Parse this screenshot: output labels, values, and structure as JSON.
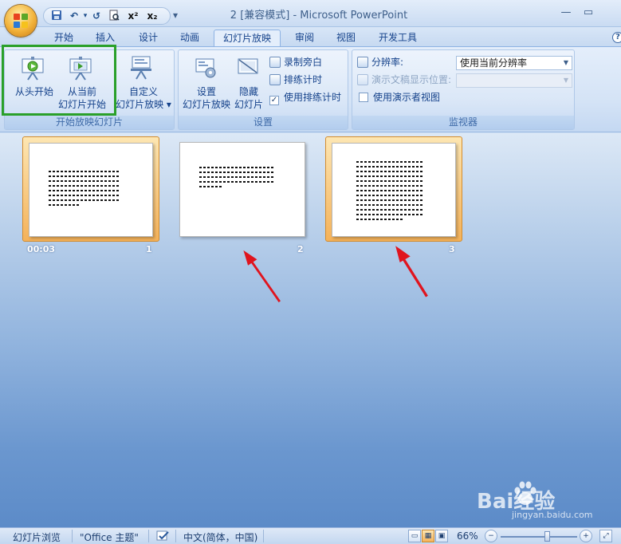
{
  "window": {
    "title": "2 [兼容模式] - Microsoft PowerPoint",
    "controls": {
      "minimize": "—",
      "maximize": "▭"
    }
  },
  "qat": {
    "undo_glyph": "↶",
    "redo_glyph": "↺",
    "superscript": "x²",
    "subscript": "x₂",
    "customize": "▾"
  },
  "tabs": [
    {
      "label": "开始"
    },
    {
      "label": "插入"
    },
    {
      "label": "设计"
    },
    {
      "label": "动画"
    },
    {
      "label": "幻灯片放映",
      "active": true
    },
    {
      "label": "审阅"
    },
    {
      "label": "视图"
    },
    {
      "label": "开发工具"
    }
  ],
  "ribbon": {
    "start_group": {
      "label": "开始放映幻灯片",
      "from_beginning": "从头开始",
      "from_current_1": "从当前",
      "from_current_2": "幻灯片开始",
      "custom_1": "自定义",
      "custom_2": "幻灯片放映 ▾"
    },
    "setup_group": {
      "label": "设置",
      "setup_1": "设置",
      "setup_2": "幻灯片放映",
      "hide_1": "隐藏",
      "hide_2": "幻灯片",
      "record_narration": "录制旁白",
      "rehearse_timings": "排练计时",
      "use_rehearsed": "使用排练计时",
      "use_rehearsed_checked": true
    },
    "monitors_group": {
      "label": "监视器",
      "resolution_label": "分辨率:",
      "resolution_value": "使用当前分辨率",
      "show_on_label": "演示文稿显示位置:",
      "show_on_value": "",
      "presenter_view": "使用演示者视图",
      "presenter_view_checked": false
    }
  },
  "slides": [
    {
      "number": "1",
      "timing": "00:03",
      "selected": true
    },
    {
      "number": "2",
      "timing": "",
      "selected": false
    },
    {
      "number": "3",
      "timing": "",
      "selected": true
    }
  ],
  "watermark": {
    "text": "Bai经验",
    "url": "jingyan.baidu.com"
  },
  "statusbar": {
    "view_name": "幻灯片浏览",
    "theme": "\"Office 主题\"",
    "language": "中文(简体，中国)",
    "zoom": "66%",
    "zoom_minus": "−",
    "zoom_plus": "+"
  },
  "colors": {
    "highlight": "#2aa02a",
    "arrow": "#e0141e",
    "selection": "#f4b25a"
  }
}
